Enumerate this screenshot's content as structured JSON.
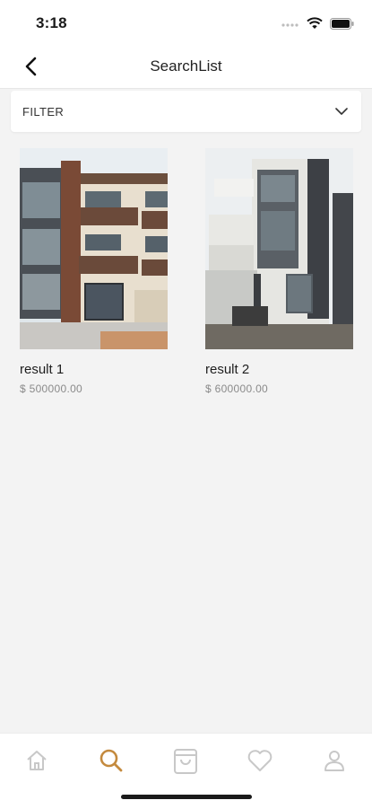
{
  "status_bar": {
    "time": "3:18"
  },
  "header": {
    "title": "SearchList"
  },
  "filter": {
    "label": "FILTER"
  },
  "results": [
    {
      "title": "result 1",
      "price": "$ 500000.00"
    },
    {
      "title": "result 2",
      "price": "$ 600000.00"
    }
  ],
  "tab_bar": {
    "active": "search",
    "items": [
      "home-icon",
      "search-icon",
      "bag-icon",
      "heart-icon",
      "profile-icon"
    ]
  },
  "colors": {
    "accent": "#c48a3e",
    "inactive_icon": "#c8c8c8",
    "background": "#f3f3f3"
  }
}
